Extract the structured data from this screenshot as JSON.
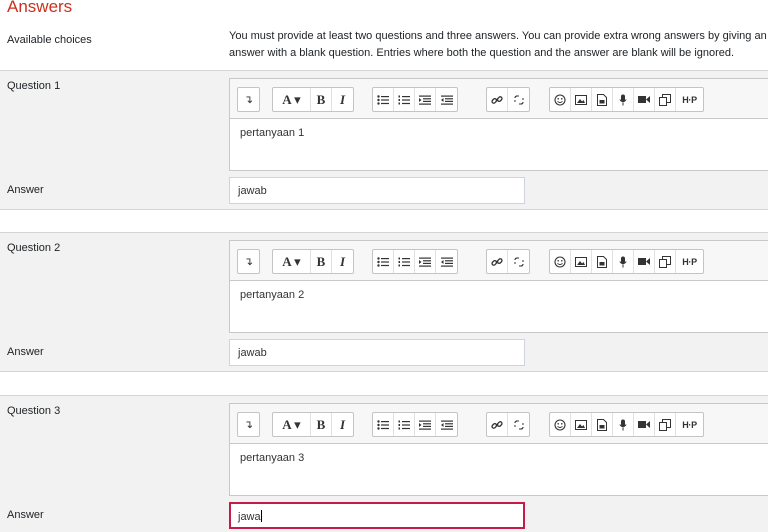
{
  "header": {
    "title": "Answers",
    "available_label": "Available choices",
    "available_text": "You must provide at least two questions and three answers. You can provide extra wrong answers by giving an answer with a blank question. Entries where both the question and the answer are blank will be ignored."
  },
  "editor_toolbar": {
    "collapse": "↴",
    "font": "A ▾",
    "bold": "B",
    "italic": "I",
    "h5p": "H·P"
  },
  "questions": [
    {
      "label": "Question 1",
      "text": "pertanyaan 1",
      "answer_label": "Answer",
      "answer": "jawab"
    },
    {
      "label": "Question 2",
      "text": "pertanyaan 2",
      "answer_label": "Answer",
      "answer": "jawab"
    },
    {
      "label": "Question 3",
      "text": "pertanyaan 3",
      "answer_label": "Answer",
      "answer": "jawa"
    }
  ],
  "colors": {
    "accent": "#ca3120",
    "focus": "#c51a4a",
    "block_bg": "#f2f2f2"
  }
}
